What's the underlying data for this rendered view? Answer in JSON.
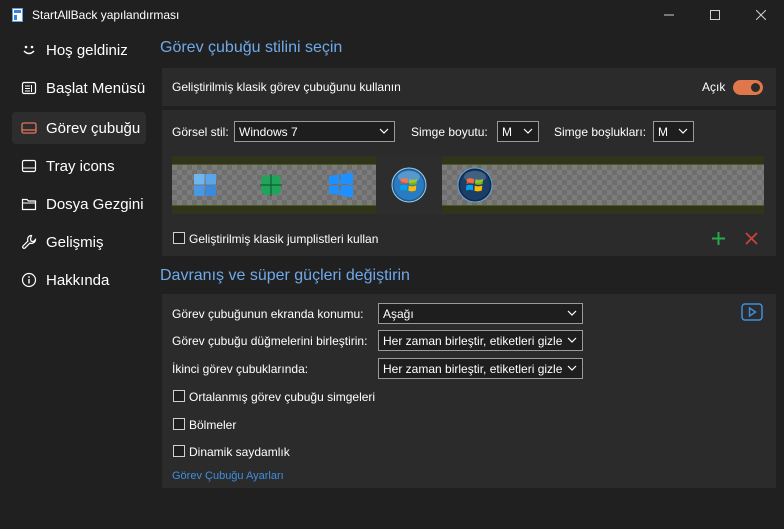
{
  "window": {
    "title": "StartAllBack yapılandırması"
  },
  "sidebar": {
    "items": [
      {
        "label": "Hoş geldiniz",
        "icon": "smile-icon"
      },
      {
        "label": "Başlat Menüsü",
        "icon": "start-menu-icon"
      },
      {
        "label": "Görev çubuğu",
        "icon": "taskbar-icon",
        "active": true
      },
      {
        "label": "Tray icons",
        "icon": "tray-icon"
      },
      {
        "label": "Dosya Gezgini",
        "icon": "folder-icon"
      },
      {
        "label": "Gelişmiş",
        "icon": "wrench-icon"
      },
      {
        "label": "Hakkında",
        "icon": "info-icon"
      }
    ]
  },
  "style_section": {
    "heading": "Görev çubuğu stilini seçin",
    "enhanced_label": "Geliştirilmiş klasik görev çubuğunu kullanın",
    "toggle_state": "Açık",
    "visual_style_label": "Görsel stil:",
    "visual_style_value": "Windows 7",
    "icon_size_label": "Simge boyutu:",
    "icon_size_value": "M",
    "icon_spacing_label": "Simge boşlukları:",
    "icon_spacing_value": "M",
    "style_options": [
      "windows-11-logo-icon",
      "clover-logo-icon",
      "windows-10-logo-icon",
      "windows-7-orb-icon",
      "windows-vista-orb-icon"
    ],
    "jumplists_label": "Geliştirilmiş klasik jumplistleri kullan"
  },
  "behavior_section": {
    "heading": "Davranış ve süper güçleri değiştirin",
    "position_label": "Görev çubuğunun ekranda konumu:",
    "position_value": "Aşağı",
    "combine_label": "Görev çubuğu düğmelerini birleştirin:",
    "combine_value": "Her zaman birleştir, etiketleri gizle",
    "secondary_label": "İkinci görev çubuklarında:",
    "secondary_value": "Her zaman birleştir, etiketleri gizle",
    "centered_label": "Ortalanmış görev çubuğu simgeleri",
    "segments_label": "Bölmeler",
    "dynamic_label": "Dinamik saydamlık",
    "settings_link": "Görev Çubuğu Ayarları"
  },
  "colors": {
    "accent": "#6fa9e8",
    "toggle_on": "#e0774a",
    "add": "#2aa84a",
    "remove": "#c9433a",
    "link": "#3f8ee0"
  }
}
